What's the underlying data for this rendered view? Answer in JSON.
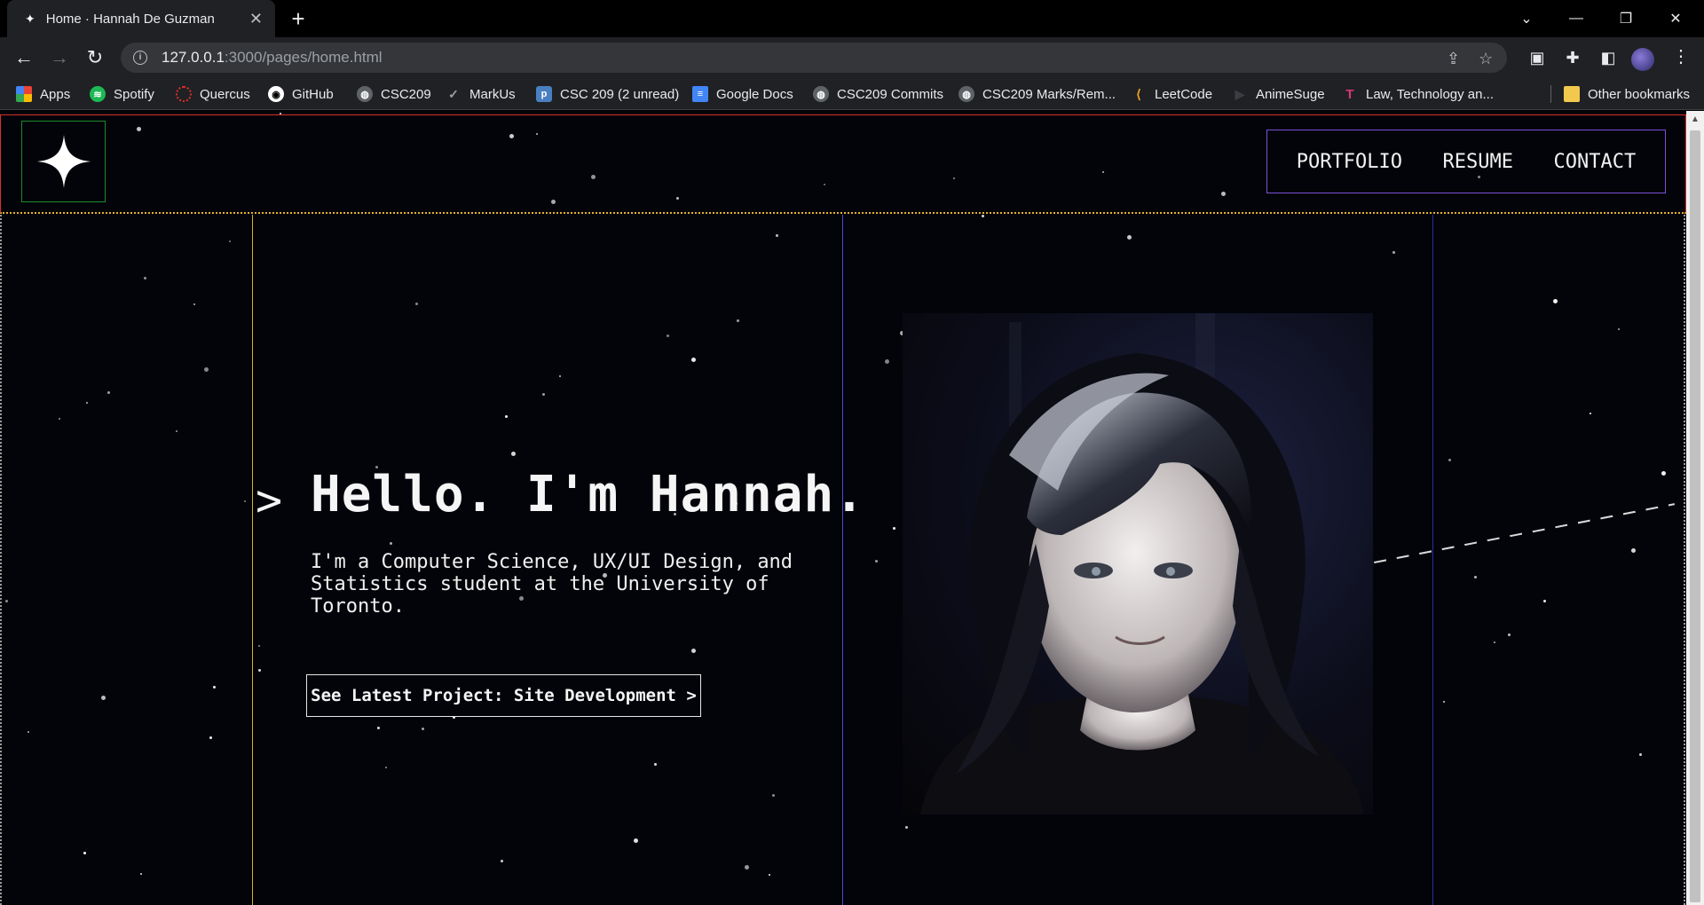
{
  "browser": {
    "tab_title": "Home · Hannah De Guzman",
    "url_host": "127.0.0.1",
    "url_rest": ":3000/pages/home.html",
    "bookmarks": [
      {
        "label": "Apps",
        "icon": "apps-grid-icon",
        "color": "#4285f4"
      },
      {
        "label": "Spotify",
        "icon": "spotify-icon",
        "color": "#1db954"
      },
      {
        "label": "Quercus",
        "icon": "quercus-icon",
        "color": "#e0302a"
      },
      {
        "label": "GitHub",
        "icon": "github-icon",
        "color": "#ffffff"
      },
      {
        "label": "CSC209",
        "icon": "globe-icon",
        "color": "#9aa0a6"
      },
      {
        "label": "MarkUs",
        "icon": "markus-check-icon",
        "color": "#9aa0a6"
      },
      {
        "label": "CSC 209 (2 unread)",
        "icon": "piazza-icon",
        "color": "#4a7fc1"
      },
      {
        "label": "Google Docs",
        "icon": "google-docs-icon",
        "color": "#4285f4"
      },
      {
        "label": "CSC209 Commits",
        "icon": "globe-icon",
        "color": "#9aa0a6"
      },
      {
        "label": "CSC209 Marks/Rem...",
        "icon": "globe-icon",
        "color": "#9aa0a6"
      },
      {
        "label": "LeetCode",
        "icon": "leetcode-icon",
        "color": "#f0a32a"
      },
      {
        "label": "AnimeSuge",
        "icon": "play-icon",
        "color": "#3a3d42"
      },
      {
        "label": "Law, Technology an...",
        "icon": "law-tech-icon",
        "color": "#d8367a"
      }
    ],
    "other_bookmarks": "Other bookmarks"
  },
  "site": {
    "nav": [
      "PORTFOLIO",
      "RESUME",
      "CONTACT"
    ],
    "hero": {
      "chevron": ">",
      "heading": "Hello. I'm Hannah.",
      "subtitle": "I'm a Computer Science, UX/UI Design, and Statistics student at the University of Toronto.",
      "cta": "See Latest Project: Site Development >"
    },
    "colors": {
      "background": "#03040a",
      "header_border": "#d9302a",
      "header_dotted": "#e3b12f",
      "logo_border": "#1d8a2b",
      "nav_border": "#7b4fd9",
      "hero_left_column": "#d4b52a",
      "hero_right_column": "#4b4bd6"
    }
  }
}
